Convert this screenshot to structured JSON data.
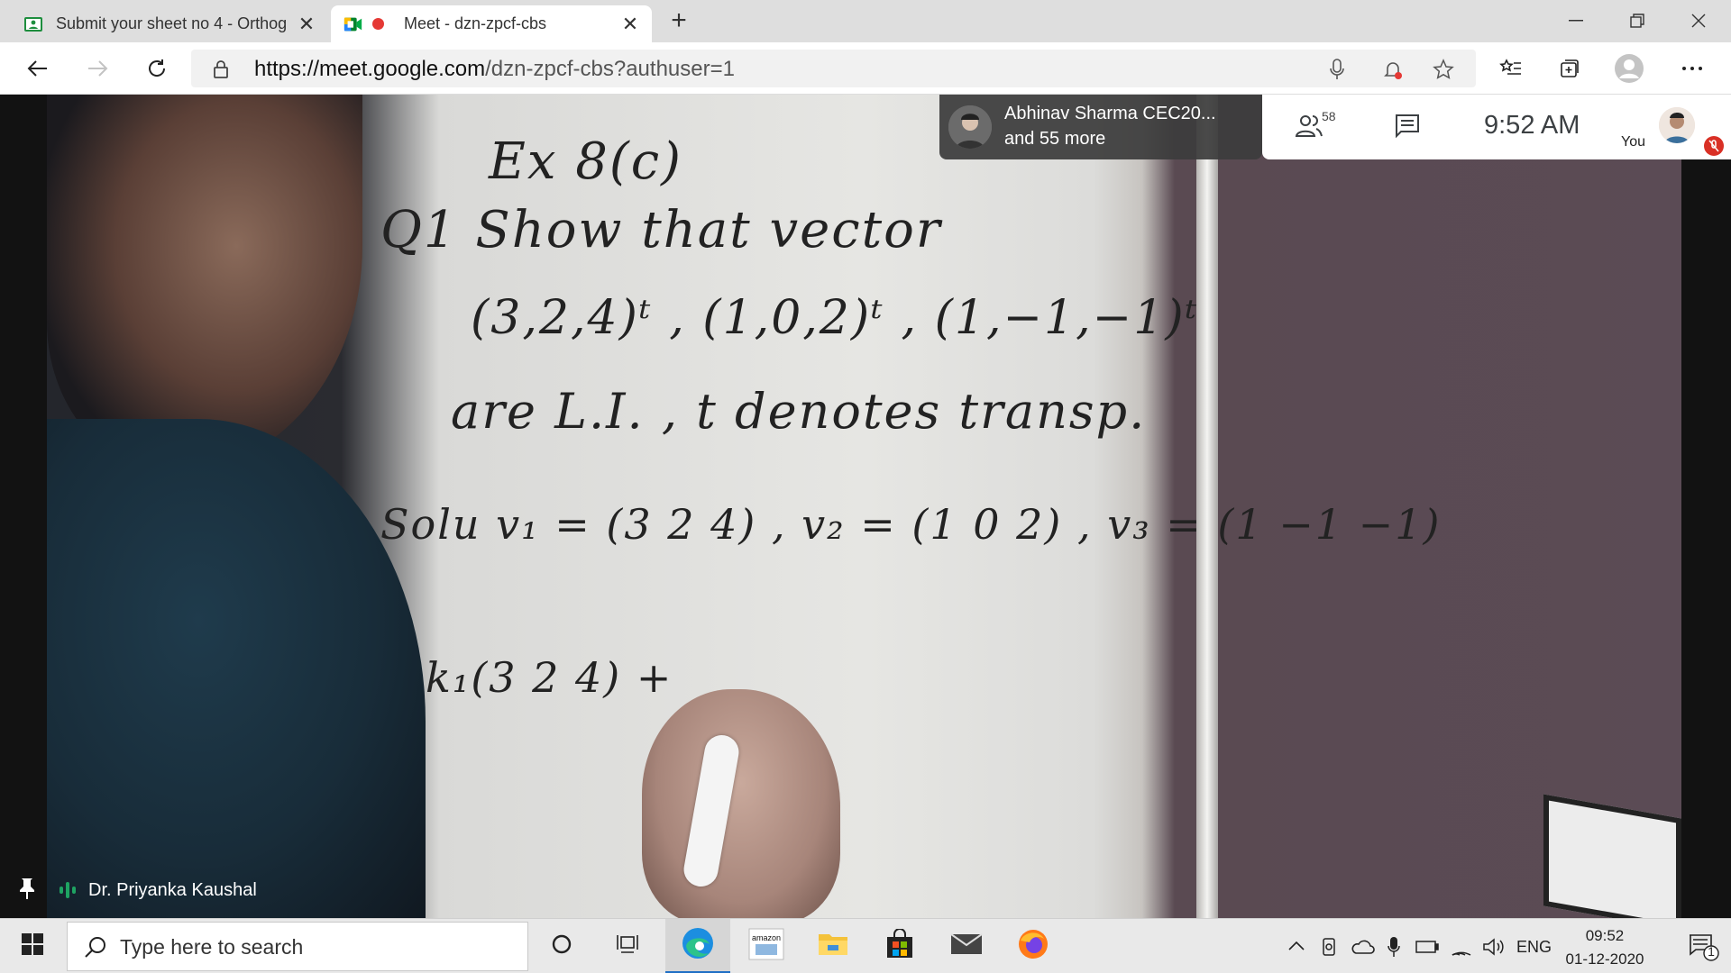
{
  "browser": {
    "tabs": [
      {
        "title": "Submit your sheet no 4 - Orthog",
        "favicon": "classroom-icon",
        "active": false
      },
      {
        "title": "Meet - dzn-zpcf-cbs",
        "favicon": "meet-icon",
        "recording": true,
        "active": true
      }
    ],
    "url_host": "https://meet.google.com",
    "url_path": "/dzn-zpcf-cbs?authuser=1"
  },
  "meet": {
    "participants_chip": {
      "line1": "Abhinav Sharma CEC20...",
      "line2": "and 55 more"
    },
    "participant_count": "58",
    "time": "9:52  AM",
    "self_label": "You",
    "speaker_name": "Dr. Priyanka Kaushal"
  },
  "whiteboard": {
    "lines": [
      "Ex 8(c)",
      "Q1  Show that vector",
      "(3,2,4)ᵗ , (1,0,2)ᵗ , (1,−1,−1)ᵗ",
      "are L.I. ,  t denotes transp.",
      "Solu   v₁ = (3 2 4) , v₂ = (1 0 2) , v₃ = (1 −1 −1)",
      "k₁(3 2 4) + "
    ]
  },
  "taskbar": {
    "search_placeholder": "Type here to search",
    "language": "ENG",
    "clock_time": "09:52",
    "clock_date": "01-12-2020",
    "notification_count": "1"
  },
  "colors": {
    "accent_blue": "#1f6fc5",
    "recording_red": "#e53935",
    "speaking_green": "#1ea362",
    "mute_red": "#d93025"
  }
}
